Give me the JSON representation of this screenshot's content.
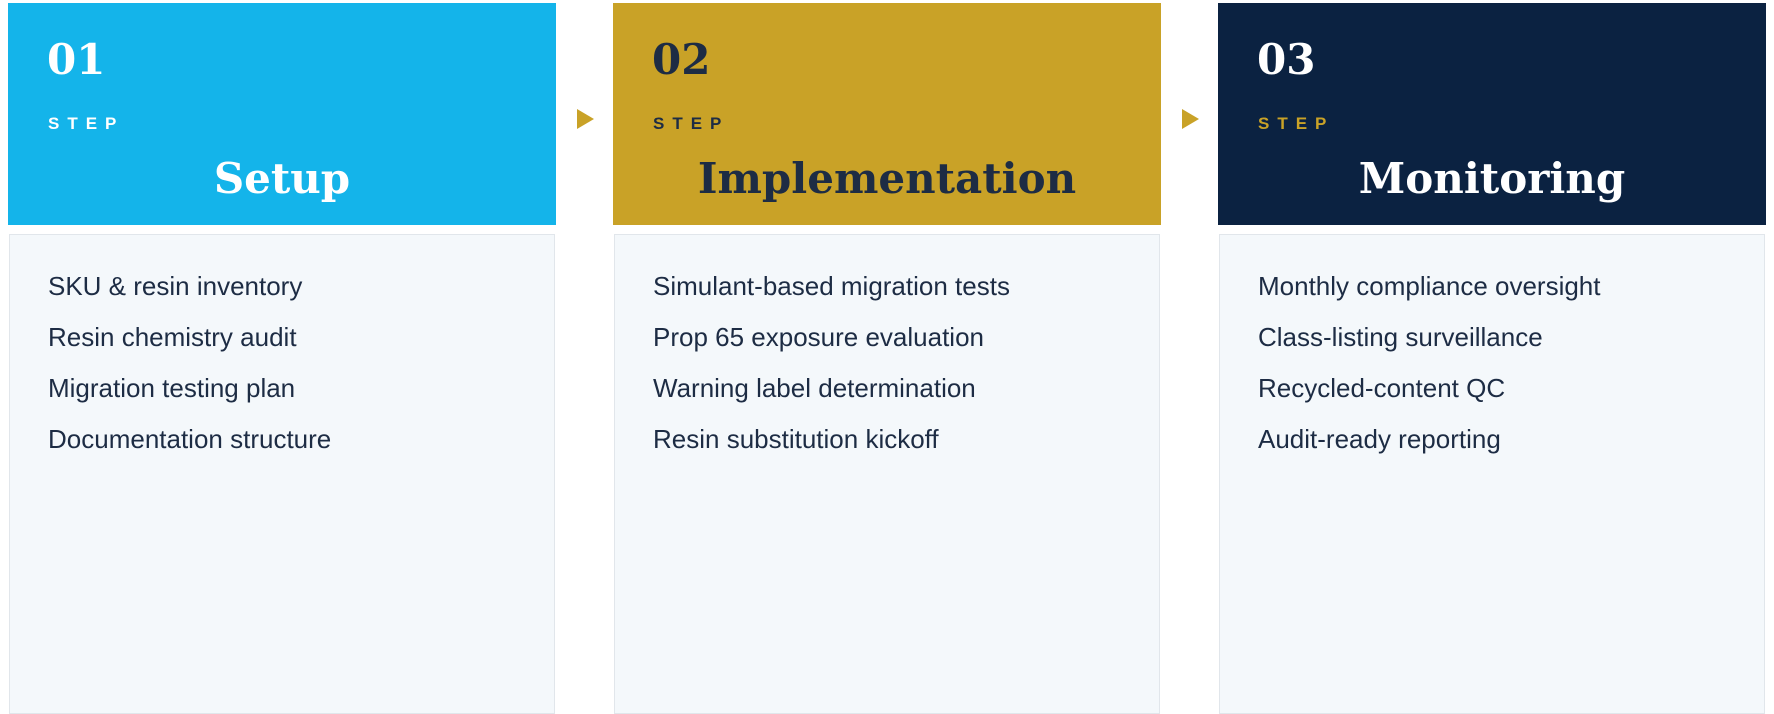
{
  "colors": {
    "step1_bg": "#14b4ea",
    "step2_bg": "#c9a227",
    "step3_bg": "#0b2241",
    "arrow": "#c9a227",
    "navy_text": "#1d2c44",
    "body_bg": "#f4f8fb"
  },
  "steps": [
    {
      "number": "01",
      "step_label": "STEP",
      "title": "Setup",
      "items": [
        "SKU & resin inventory",
        "Resin chemistry audit",
        "Migration testing plan",
        "Documentation structure"
      ]
    },
    {
      "number": "02",
      "step_label": "STEP",
      "title": "Implementation",
      "items": [
        "Simulant-based migration tests",
        "Prop 65 exposure evaluation",
        "Warning label determination",
        "Resin substitution kickoff"
      ]
    },
    {
      "number": "03",
      "step_label": "STEP",
      "title": "Monitoring",
      "items": [
        "Monthly compliance oversight",
        "Class-listing surveillance",
        "Recycled-content QC",
        "Audit-ready reporting"
      ]
    }
  ]
}
